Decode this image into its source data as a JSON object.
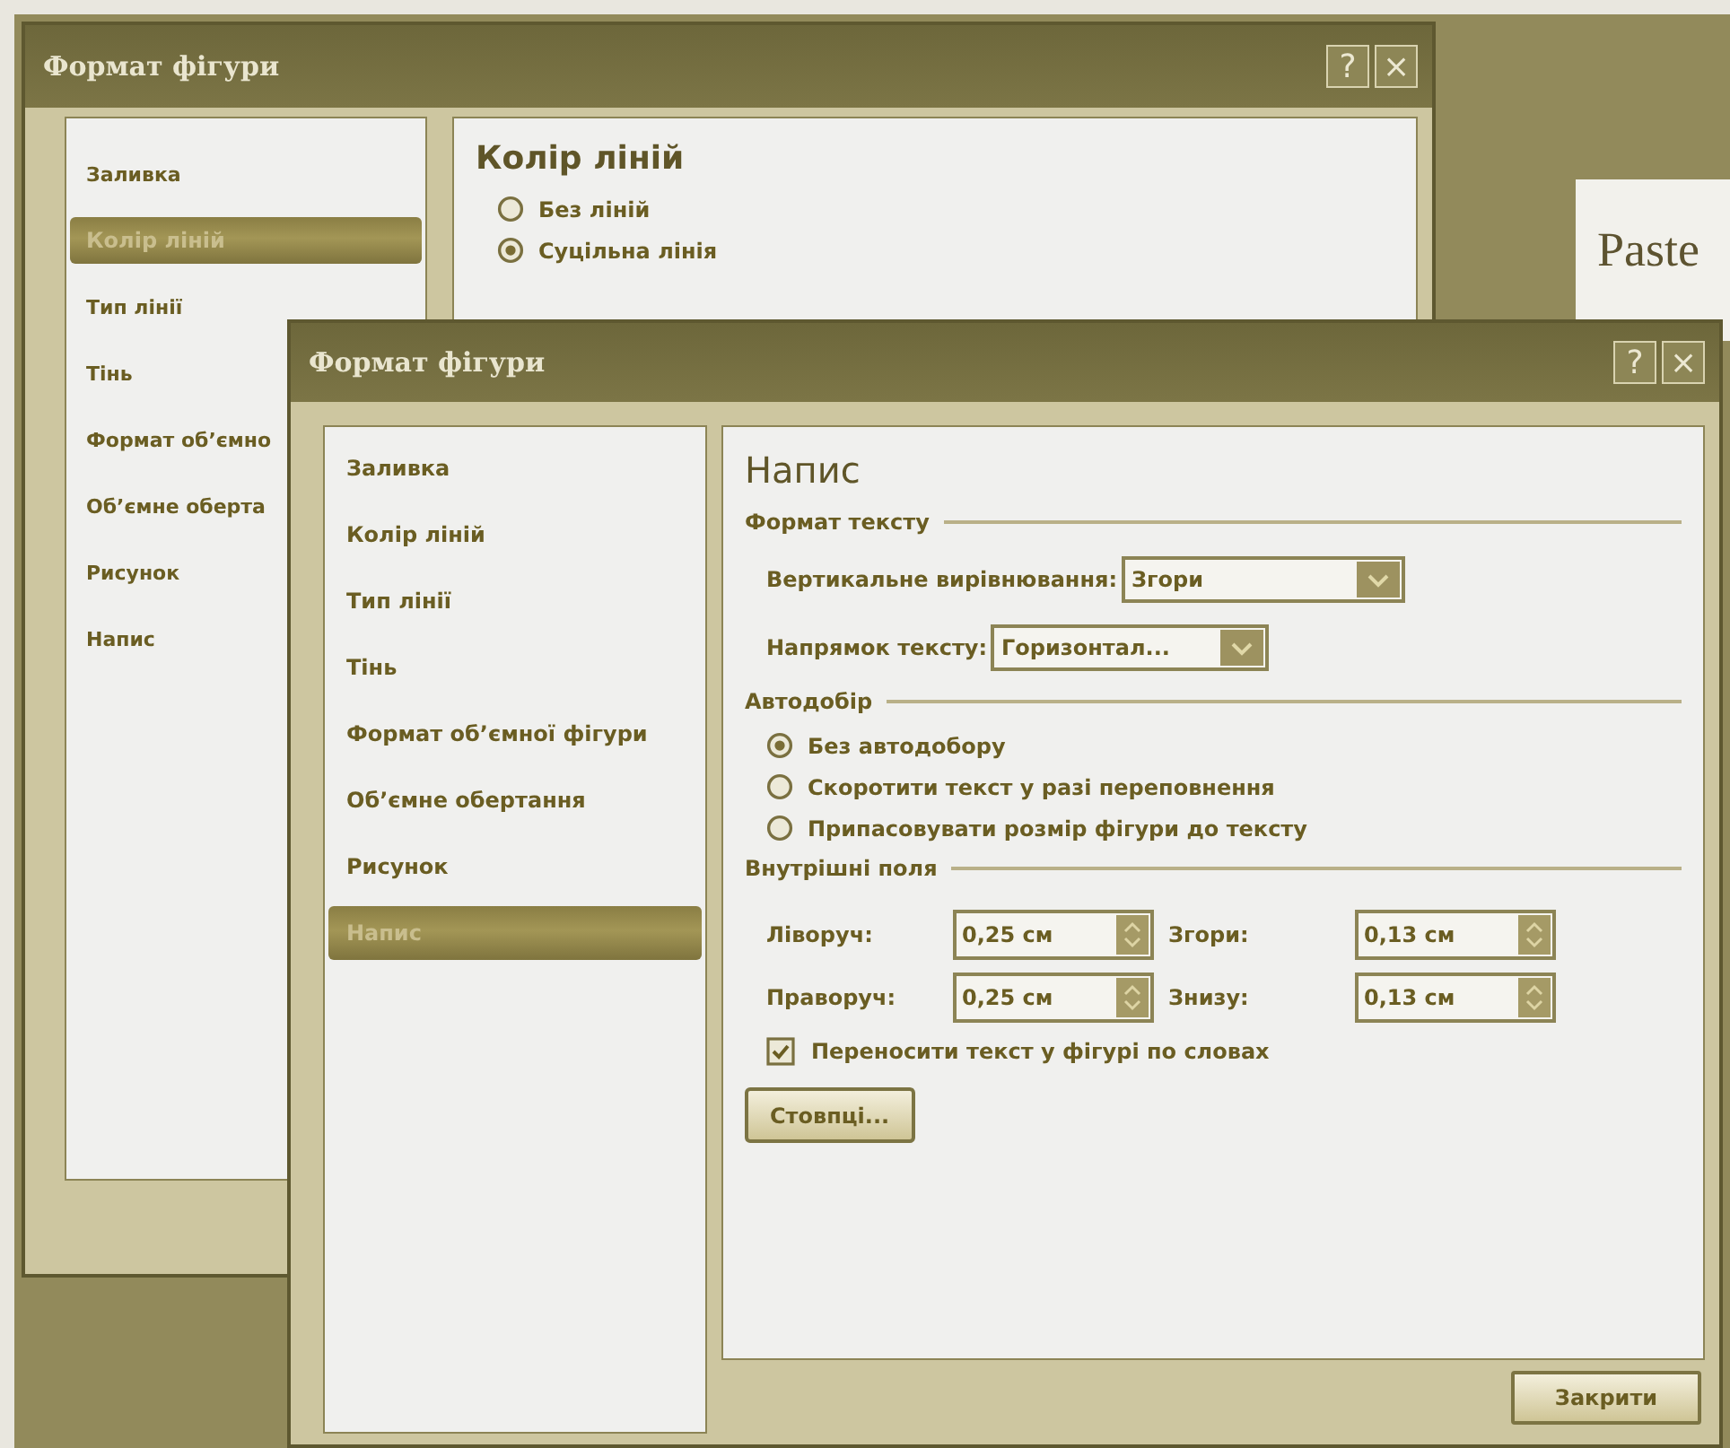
{
  "slide": {
    "text": "Paste"
  },
  "dialogs": [
    {
      "kind": "back",
      "title": "Формат фігури",
      "help_button": "?",
      "close_button": "×",
      "sidebar": [
        {
          "label": "Заливка",
          "selected": false
        },
        {
          "label": "Колір ліній",
          "selected": true
        },
        {
          "label": "Тип лінії",
          "selected": false
        },
        {
          "label": "Тінь",
          "selected": false
        },
        {
          "label": "Формат об’ємно",
          "selected": false
        },
        {
          "label": "Об’ємне оберта",
          "selected": false
        },
        {
          "label": "Рисунок",
          "selected": false
        },
        {
          "label": "Напис",
          "selected": false
        }
      ],
      "panel": {
        "heading": "Колір ліній",
        "sections": [
          {
            "kind": "radios",
            "options": [
              {
                "label": "Без ліній",
                "selected": false
              },
              {
                "label": "Суцільна лінія",
                "selected": true
              }
            ]
          }
        ]
      }
    },
    {
      "kind": "front",
      "title": "Формат фігури",
      "help_button": "?",
      "close_button": "×",
      "sidebar": [
        {
          "label": "Заливка",
          "selected": false
        },
        {
          "label": "Колір ліній",
          "selected": false
        },
        {
          "label": "Тип лінії",
          "selected": false
        },
        {
          "label": "Тінь",
          "selected": false
        },
        {
          "label": "Формат об’ємної фігури",
          "selected": false
        },
        {
          "label": "Об’ємне обертання",
          "selected": false
        },
        {
          "label": "Рисунок",
          "selected": false
        },
        {
          "label": "Напис",
          "selected": true
        }
      ],
      "panel": {
        "heading": "Напис",
        "sections": [
          {
            "kind": "dropdowns",
            "title": "Формат тексту",
            "rows": [
              {
                "label": "Вертикальне вирівнювання:",
                "value": "Згори"
              },
              {
                "label": "Напрямок тексту:",
                "value": "Горизонтал..."
              }
            ]
          },
          {
            "kind": "radios",
            "title": "Автодобір",
            "options": [
              {
                "label": "Без автодобору",
                "selected": true
              },
              {
                "label": "Скоротити текст у разі переповнення",
                "selected": false
              },
              {
                "label": "Припасовувати розмір фігури до тексту",
                "selected": false
              }
            ]
          },
          {
            "kind": "spinners",
            "title": "Внутрішні поля",
            "fields": [
              {
                "label": "Ліворуч:",
                "value": "0,25 см"
              },
              {
                "label": "Згори:",
                "value": "0,13 см"
              },
              {
                "label": "Праворуч:",
                "value": "0,25 см"
              },
              {
                "label": "Знизу:",
                "value": "0,13 см"
              }
            ],
            "checkbox": {
              "label": "Переносити текст у фігурі по словах",
              "checked": true
            },
            "button": "Стовпці..."
          }
        ]
      },
      "footer_button": "Закрити"
    }
  ]
}
